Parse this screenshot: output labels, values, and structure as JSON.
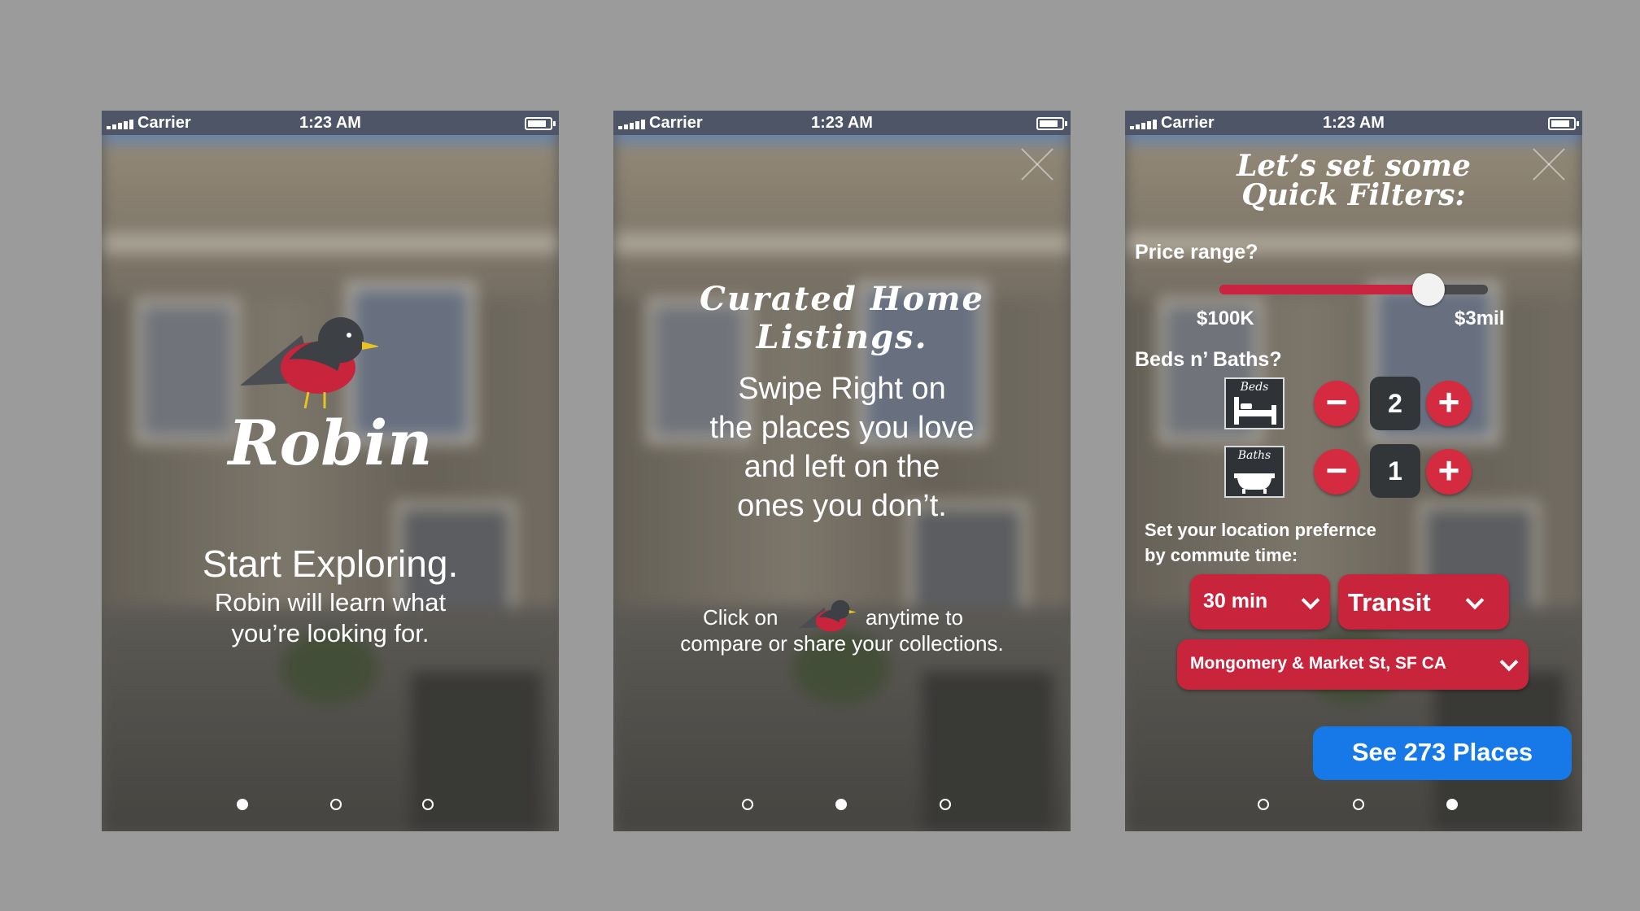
{
  "status_bar": {
    "carrier": "Carrier",
    "time": "1:23 AM"
  },
  "screen1": {
    "logo": "Robin",
    "headline": "Start Exploring.",
    "subtitle_line1": "Robin will learn what",
    "subtitle_line2": "you’re looking for.",
    "page_index": 0
  },
  "screen2": {
    "title": "Curated Home Listings.",
    "body_line1": "Swipe Right on",
    "body_line2": "the places you love",
    "body_line3": "and left on the",
    "body_line4": "ones you don’t.",
    "click_prefix": "Click on",
    "click_suffix": "anytime to",
    "click_line2": "compare or share your collections.",
    "page_index": 1
  },
  "screen3": {
    "title_line1": "Let’s set some",
    "title_line2": "Quick Filters:",
    "price_label": "Price range?",
    "price_min": "$100K",
    "price_max": "$3mil",
    "price_slider_fraction": 0.78,
    "beds_baths_label": "Beds n’ Baths?",
    "beds_caption": "Beds",
    "beds_value": "2",
    "baths_caption": "Baths",
    "baths_value": "1",
    "minus_symbol": "−",
    "plus_symbol": "+",
    "location_label_line1": "Set your location prefernce",
    "location_label_line2": "by commute time:",
    "commute_time": "30 min",
    "commute_mode": "Transit",
    "address": "Mongomery & Market St, SF CA",
    "cta": "See 273 Places",
    "page_index": 2
  },
  "colors": {
    "status_bar": "#4e5566",
    "robin_red": "#c8253c",
    "cta_blue": "#1778e8",
    "background": "#9b9b9b"
  },
  "icons": [
    "signal-icon",
    "battery-icon",
    "close-icon",
    "robin-bird-icon",
    "bed-icon",
    "bathtub-icon",
    "chevron-down-icon"
  ]
}
